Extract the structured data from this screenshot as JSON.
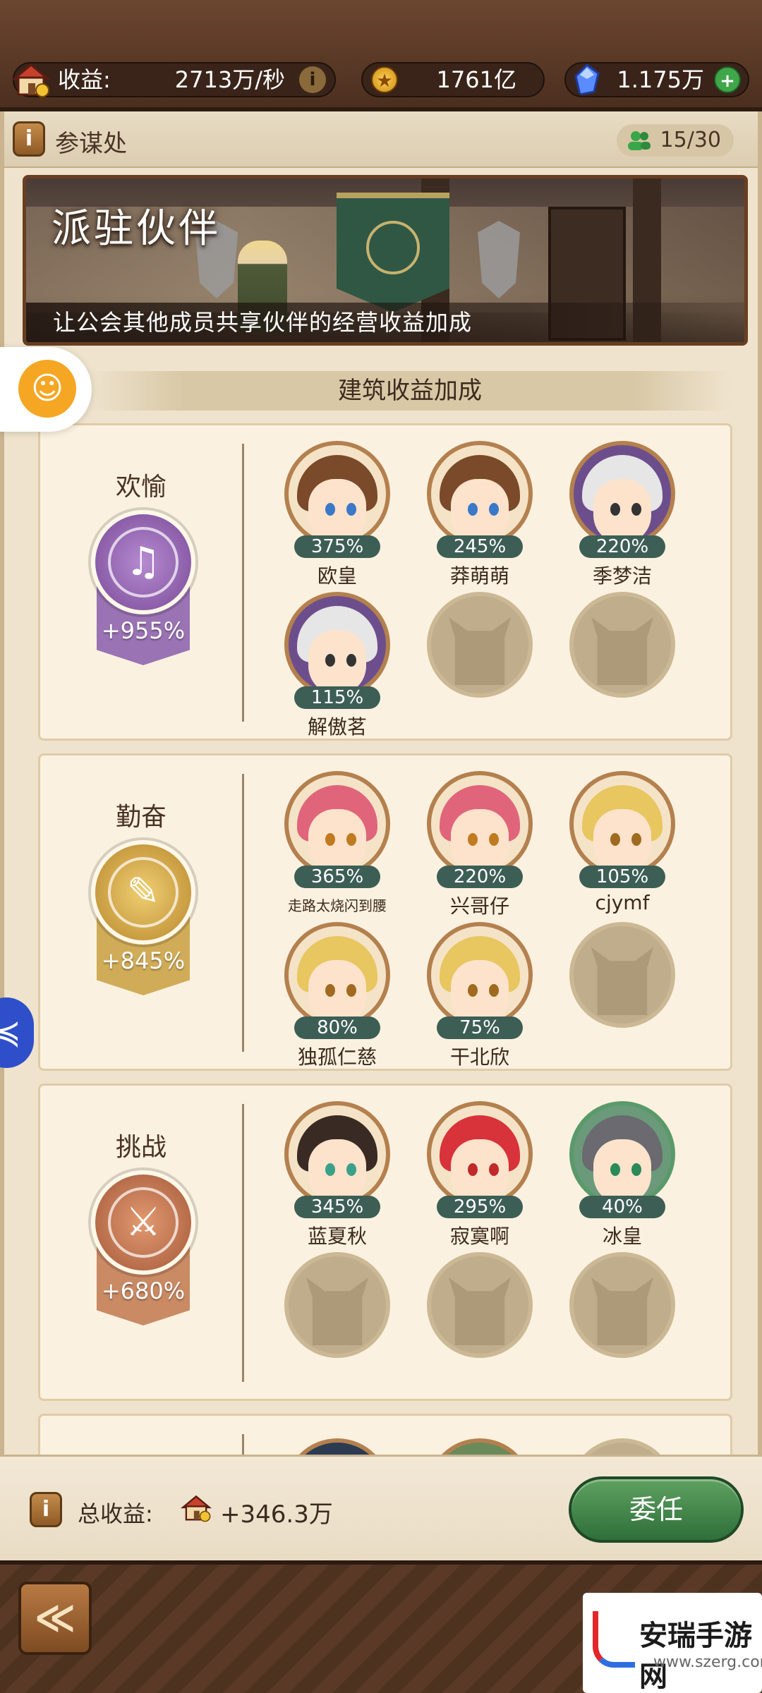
{
  "topbar": {
    "income_label": "收益:",
    "income_value": "2713万/秒",
    "gold_value": "1761亿",
    "gem_value": "1.175万",
    "info_icon": "i",
    "plus_icon": "+"
  },
  "panel": {
    "title": "参谋处",
    "member_count": "15/30",
    "info_icon": "i"
  },
  "banner": {
    "title": "派驻伙伴",
    "subtitle": "让公会其他成员共享伙伴的经营收益加成"
  },
  "section_title": "建筑收益加成",
  "categories": [
    {
      "name": "欢愉",
      "bonus": "+955%",
      "color": "#8e5aa8",
      "slots": [
        {
          "name": "欧皇",
          "pct": "375%"
        },
        {
          "name": "莽萌萌",
          "pct": "245%"
        },
        {
          "name": "季梦洁",
          "pct": "220%"
        },
        {
          "name": "解傲茗",
          "pct": "115%"
        }
      ]
    },
    {
      "name": "勤奋",
      "bonus": "+845%",
      "color": "#c9a040",
      "slots": [
        {
          "name": "走路太烧闪到腰",
          "pct": "365%"
        },
        {
          "name": "兴哥仔",
          "pct": "220%"
        },
        {
          "name": "cjymf",
          "pct": "105%"
        },
        {
          "name": "独孤仁慈",
          "pct": "80%"
        },
        {
          "name": "干北欣",
          "pct": "75%"
        }
      ]
    },
    {
      "name": "挑战",
      "bonus": "+680%",
      "color": "#c47a52",
      "slots": [
        {
          "name": "蓝夏秋",
          "pct": "345%"
        },
        {
          "name": "寂寞啊",
          "pct": "295%"
        },
        {
          "name": "冰皇",
          "pct": "40%"
        }
      ]
    }
  ],
  "footer": {
    "total_label": "总收益:",
    "total_value": "+346.3万",
    "appoint_label": "委任",
    "info_icon": "i"
  },
  "watermark": {
    "title": "安瑞手游网",
    "url": "www.szerg.com"
  },
  "colors": {
    "accent_green": "#3d5e55",
    "button_green": "#3f8a4a",
    "wood_brown": "#5a3a26"
  }
}
